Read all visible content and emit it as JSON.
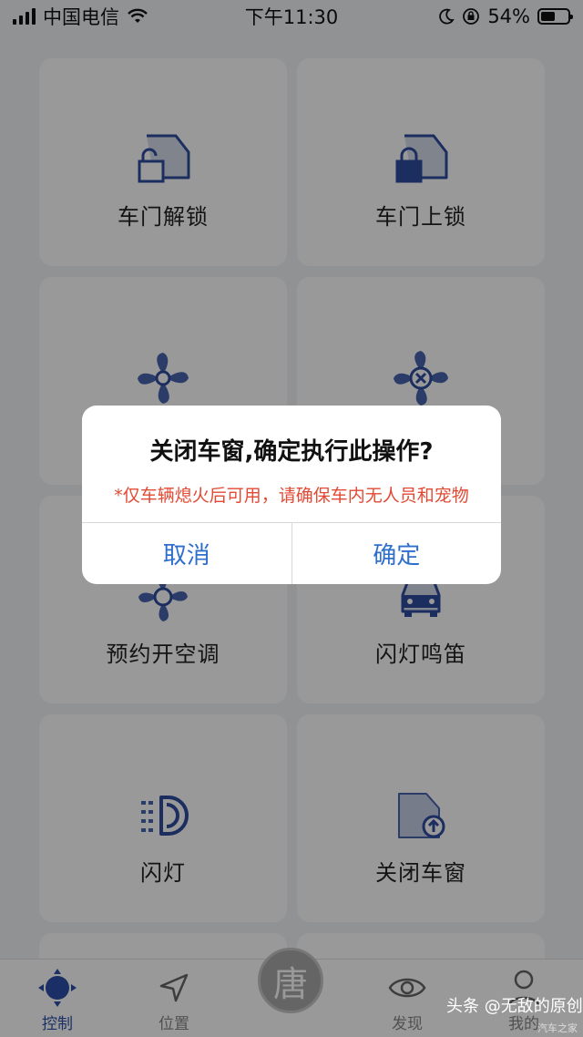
{
  "status_bar": {
    "carrier": "中国电信",
    "time": "下午11:30",
    "battery": "54%",
    "battery_level": 0.54
  },
  "tiles": [
    {
      "label": "车门解锁",
      "icon": "door-unlock-icon"
    },
    {
      "label": "车门上锁",
      "icon": "door-lock-icon"
    },
    {
      "label": "",
      "icon": "fan-icon"
    },
    {
      "label": "",
      "icon": "fan-off-icon"
    },
    {
      "label": "预约开空调",
      "icon": "ac-schedule-icon"
    },
    {
      "label": "闪灯鸣笛",
      "icon": "car-horn-icon"
    },
    {
      "label": "闪灯",
      "icon": "headlight-icon"
    },
    {
      "label": "关闭车窗",
      "icon": "window-close-icon"
    }
  ],
  "dialog": {
    "title": "关闭车窗,确定执行此操作?",
    "note": "*仅车辆熄火后可用，请确保车内无人员和宠物",
    "cancel": "取消",
    "confirm": "确定"
  },
  "tabbar": {
    "tabs": [
      {
        "label": "控制",
        "icon": "control-icon",
        "active": true
      },
      {
        "label": "位置",
        "icon": "location-icon",
        "active": false
      },
      {
        "label": "发现",
        "icon": "discover-icon",
        "active": false
      },
      {
        "label": "我的",
        "icon": "profile-icon",
        "active": false
      }
    ],
    "center": "唐"
  },
  "watermark": {
    "main": "头条 @无敌的原创",
    "sub": "汽车之家"
  },
  "colors": {
    "accent": "#2a4fa8",
    "icon_blue": "#2f4ea0",
    "warning": "#e24a35",
    "link": "#2f6fcc"
  }
}
